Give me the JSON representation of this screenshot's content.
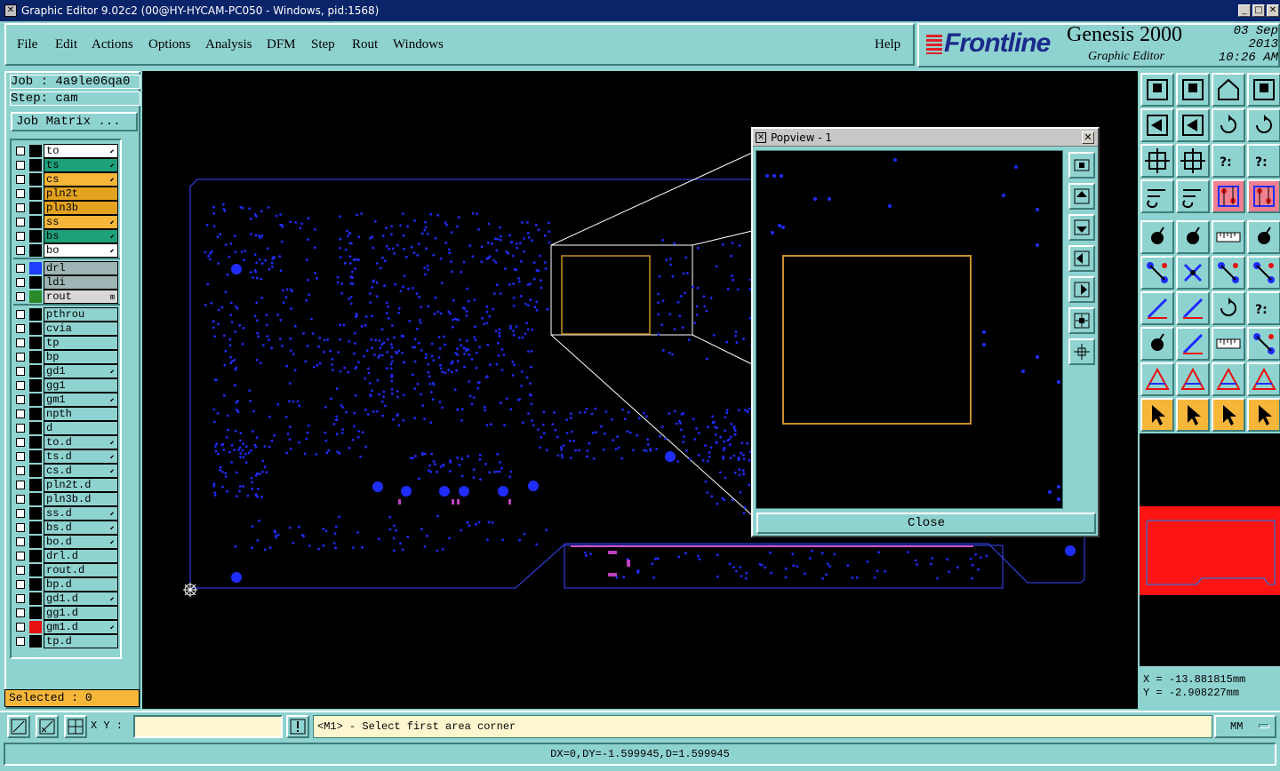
{
  "window": {
    "title": "Graphic Editor 9.02c2 (00@HY-HYCAM-PC050 - Windows, pid:1568)"
  },
  "menu": {
    "file": "File",
    "edit": "Edit",
    "actions": "Actions",
    "options": "Options",
    "analysis": "Analysis",
    "dfm": "DFM",
    "step": "Step",
    "rout": "Rout",
    "windows": "Windows",
    "help": "Help"
  },
  "brand": {
    "logo": "Frontline",
    "product": "Genesis 2000",
    "subtitle": "Graphic Editor",
    "date": "03 Sep 2013",
    "time": "10:26 AM"
  },
  "job": {
    "job_line": "Job : 4a9le06qa0",
    "step_line": "Step: cam",
    "matrix_button": "Job Matrix ..."
  },
  "layers": [
    {
      "name": "to",
      "color": "#ffffff",
      "swatch": "#000000",
      "mark": "⬋"
    },
    {
      "name": "ts",
      "color": "#1ea07a",
      "swatch": "#000000",
      "mark": "⬋"
    },
    {
      "name": "cs",
      "color": "#f5b63a",
      "swatch": "#000000",
      "mark": "⬋"
    },
    {
      "name": "pln2t",
      "color": "#e4a31f",
      "swatch": "#000000",
      "mark": ""
    },
    {
      "name": "pln3b",
      "color": "#e4a31f",
      "swatch": "#000000",
      "mark": ""
    },
    {
      "name": "ss",
      "color": "#f5b63a",
      "swatch": "#000000",
      "mark": "⬋"
    },
    {
      "name": "bs",
      "color": "#1ea07a",
      "swatch": "#000000",
      "mark": "⬋"
    },
    {
      "name": "bo",
      "color": "#ffffff",
      "swatch": "#000000",
      "mark": "⬋"
    },
    {
      "name": "drl",
      "color": "#9fb4b4",
      "swatch": "#1f3dff",
      "mark": ""
    },
    {
      "name": "ldi",
      "color": "#9fb4b4",
      "swatch": "#000000",
      "mark": ""
    },
    {
      "name": "rout",
      "color": "#d8d8d8",
      "swatch": "#2a8a2a",
      "mark": "⊞"
    },
    {
      "name": "pthrou",
      "color": "#8fd3d0",
      "swatch": "#000000",
      "mark": ""
    },
    {
      "name": "cvia",
      "color": "#8fd3d0",
      "swatch": "#000000",
      "mark": ""
    },
    {
      "name": "tp",
      "color": "#8fd3d0",
      "swatch": "#000000",
      "mark": ""
    },
    {
      "name": "bp",
      "color": "#8fd3d0",
      "swatch": "#000000",
      "mark": ""
    },
    {
      "name": "gd1",
      "color": "#8fd3d0",
      "swatch": "#000000",
      "mark": "⬋"
    },
    {
      "name": "gg1",
      "color": "#8fd3d0",
      "swatch": "#000000",
      "mark": ""
    },
    {
      "name": "gm1",
      "color": "#8fd3d0",
      "swatch": "#000000",
      "mark": "⬋"
    },
    {
      "name": "npth",
      "color": "#8fd3d0",
      "swatch": "#000000",
      "mark": ""
    },
    {
      "name": "d",
      "color": "#8fd3d0",
      "swatch": "#000000",
      "mark": ""
    },
    {
      "name": "to.d",
      "color": "#8fd3d0",
      "swatch": "#000000",
      "mark": "⬋"
    },
    {
      "name": "ts.d",
      "color": "#8fd3d0",
      "swatch": "#000000",
      "mark": "⬋"
    },
    {
      "name": "cs.d",
      "color": "#8fd3d0",
      "swatch": "#000000",
      "mark": "⬋"
    },
    {
      "name": "pln2t.d",
      "color": "#8fd3d0",
      "swatch": "#000000",
      "mark": ""
    },
    {
      "name": "pln3b.d",
      "color": "#8fd3d0",
      "swatch": "#000000",
      "mark": ""
    },
    {
      "name": "ss.d",
      "color": "#8fd3d0",
      "swatch": "#000000",
      "mark": "⬋"
    },
    {
      "name": "bs.d",
      "color": "#8fd3d0",
      "swatch": "#000000",
      "mark": "⬋"
    },
    {
      "name": "bo.d",
      "color": "#8fd3d0",
      "swatch": "#000000",
      "mark": "⬋"
    },
    {
      "name": "drl.d",
      "color": "#8fd3d0",
      "swatch": "#000000",
      "mark": ""
    },
    {
      "name": "rout.d",
      "color": "#8fd3d0",
      "swatch": "#000000",
      "mark": ""
    },
    {
      "name": "bp.d",
      "color": "#8fd3d0",
      "swatch": "#000000",
      "mark": ""
    },
    {
      "name": "gd1.d",
      "color": "#8fd3d0",
      "swatch": "#000000",
      "mark": "⬋"
    },
    {
      "name": "gg1.d",
      "color": "#8fd3d0",
      "swatch": "#000000",
      "mark": ""
    },
    {
      "name": "gm1.d",
      "color": "#8fd3d0",
      "swatch": "#e81010",
      "mark": "⬋"
    },
    {
      "name": "tp.d",
      "color": "#8fd3d0",
      "swatch": "#000000",
      "mark": ""
    }
  ],
  "selected_text": "Selected : 0",
  "popview": {
    "title": "Popview - 1",
    "close_label": "Close"
  },
  "coords": {
    "x_line": "X = -13.881815mm",
    "y_line": "Y = -2.908227mm"
  },
  "command": {
    "xy_label": "X Y :",
    "xy_value": "",
    "prompt": "<M1> - Select first area corner",
    "units": "MM"
  },
  "status": "DX=0,DY=-1.599945,D=1.599945",
  "colors": {
    "panel": "#8fd3d0",
    "canvas": "#000000",
    "pad": "#1f2dff",
    "outline": "#3a49ff",
    "highlight": "#f5b63a",
    "overview_red": "#ff1414"
  }
}
